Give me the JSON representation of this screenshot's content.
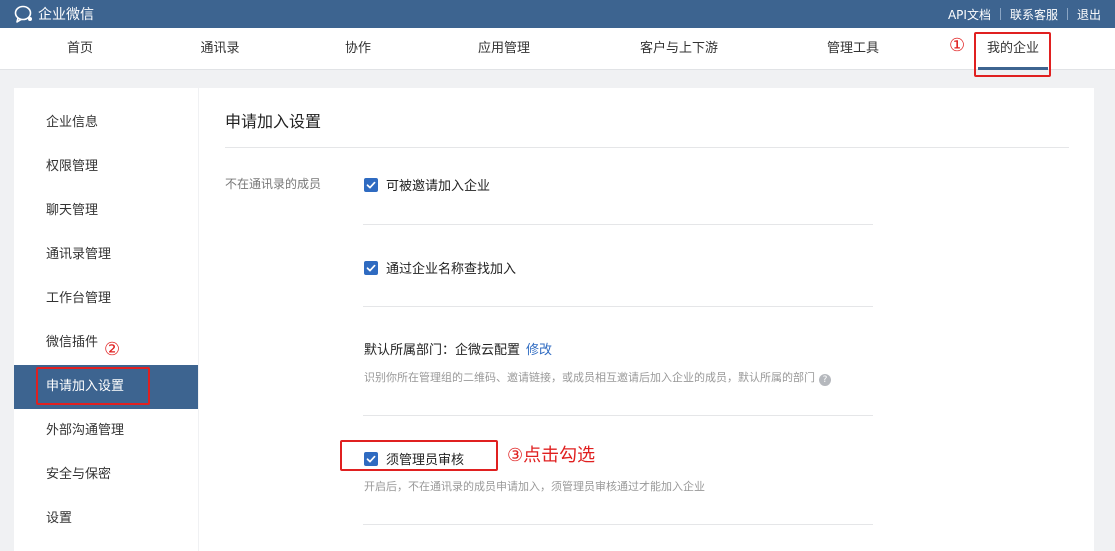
{
  "app": {
    "title": "企业微信"
  },
  "top_links": [
    "API文档",
    "联系客服",
    "退出"
  ],
  "nav": {
    "items": [
      "首页",
      "通讯录",
      "协作",
      "应用管理",
      "客户与上下游",
      "管理工具",
      "我的企业"
    ],
    "active": "我的企业"
  },
  "sidebar": {
    "items": [
      "企业信息",
      "权限管理",
      "聊天管理",
      "通讯录管理",
      "工作台管理",
      "微信插件",
      "申请加入设置",
      "外部沟通管理",
      "安全与保密",
      "设置"
    ],
    "active": "申请加入设置"
  },
  "main": {
    "title": "申请加入设置",
    "row_label": "不在通讯录的成员",
    "opt_invite": "可被邀请加入企业",
    "opt_search": "通过企业名称查找加入",
    "dept_label": "默认所属部门：",
    "dept_value": "企微云配置",
    "dept_modify": "修改",
    "dept_help": "识别你所在管理组的二维码、邀请链接，或成员相互邀请后加入企业的成员，默认所属的部门",
    "opt_review": "须管理员审核",
    "review_help": "开启后，不在通讯录的成员申请加入，须管理员审核通过才能加入企业"
  },
  "annotations": {
    "step1": "①",
    "step2": "②",
    "step3": "③点击勾选"
  },
  "colors": {
    "brand": "#3d6490",
    "checkbox": "#2f6bc1",
    "annotation": "#e02020"
  },
  "icons": {
    "logo": "wecom-logo-icon",
    "check": "check-icon",
    "help": "question-icon"
  }
}
